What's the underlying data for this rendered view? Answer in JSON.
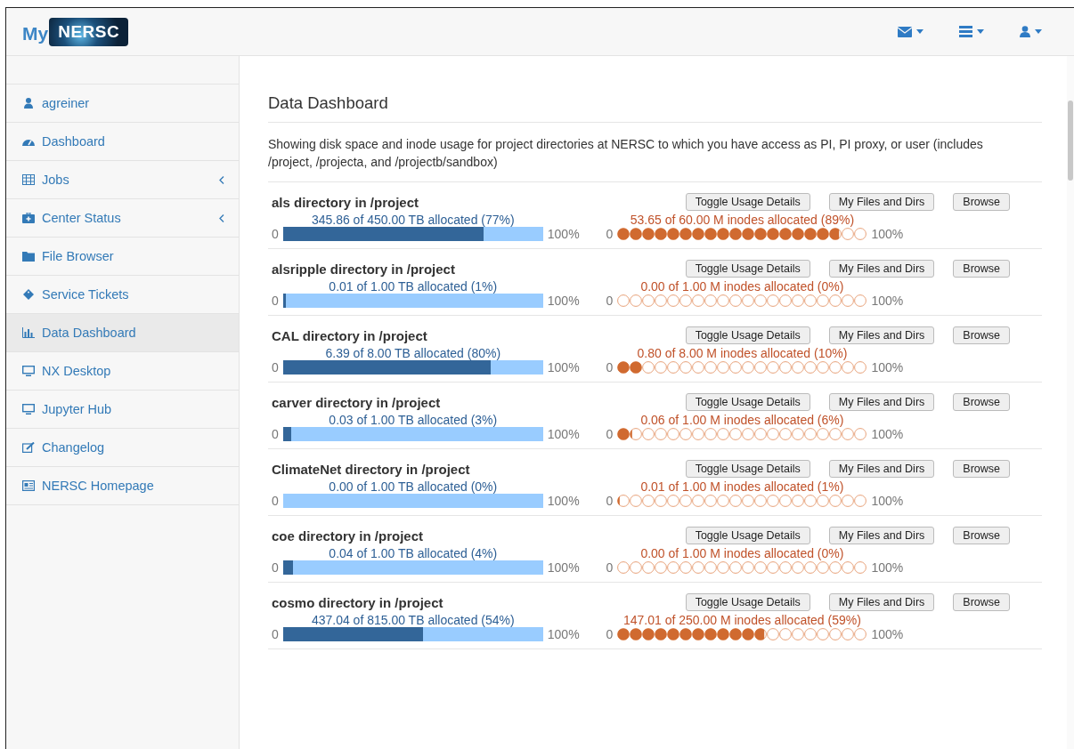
{
  "logo": {
    "prefix": "My",
    "brand": "NERSC"
  },
  "navbar": {
    "menus": [
      {
        "kind": "mail"
      },
      {
        "kind": "servers"
      },
      {
        "kind": "user"
      }
    ]
  },
  "sidebar": {
    "items": [
      {
        "label": "agreiner",
        "selected": false,
        "expandable": false
      },
      {
        "label": "Dashboard",
        "selected": false,
        "expandable": false
      },
      {
        "label": "Jobs",
        "selected": false,
        "expandable": true
      },
      {
        "label": "Center Status",
        "selected": false,
        "expandable": true
      },
      {
        "label": "File Browser",
        "selected": false,
        "expandable": false
      },
      {
        "label": "Service Tickets",
        "selected": false,
        "expandable": false
      },
      {
        "label": "Data Dashboard",
        "selected": true,
        "expandable": false
      },
      {
        "label": "NX Desktop",
        "selected": false,
        "expandable": false
      },
      {
        "label": "Jupyter Hub",
        "selected": false,
        "expandable": false
      },
      {
        "label": "Changelog",
        "selected": false,
        "expandable": false
      },
      {
        "label": "NERSC Homepage",
        "selected": false,
        "expandable": false
      }
    ]
  },
  "page": {
    "title": "Data Dashboard",
    "description": "Showing disk space and inode usage for project directories at NERSC to which you have access as PI, PI proxy, or user (includes /project, /projecta, and /projectb/sandbox)"
  },
  "directories": [
    {
      "name": "als directory in /project",
      "buttons": [
        "Toggle Usage Details",
        "My Files and Dirs",
        "Browse"
      ],
      "space": {
        "label": "345.86 of 450.00 TB allocated (77%)",
        "min": "0",
        "max": "100%",
        "level": 0.77
      },
      "inodes": {
        "label": "53.65 of 60.00 M inodes allocated (89%)",
        "min": "0",
        "max": "100%",
        "level": 0.89
      }
    },
    {
      "name": "alsripple directory in /project",
      "buttons": [
        "Toggle Usage Details",
        "My Files and Dirs",
        "Browse"
      ],
      "space": {
        "label": "0.01 of 1.00 TB allocated (1%)",
        "min": "0",
        "max": "100%",
        "level": 0.01
      },
      "inodes": {
        "label": "0.00 of 1.00 M inodes allocated (0%)",
        "min": "0",
        "max": "100%",
        "level": 0
      }
    },
    {
      "name": "CAL directory in /project",
      "buttons": [
        "Toggle Usage Details",
        "My Files and Dirs",
        "Browse"
      ],
      "space": {
        "label": "6.39 of 8.00 TB allocated (80%)",
        "min": "0",
        "max": "100%",
        "level": 0.8
      },
      "inodes": {
        "label": "0.80 of 8.00 M inodes allocated (10%)",
        "min": "0",
        "max": "100%",
        "level": 0.1
      }
    },
    {
      "name": "carver directory in /project",
      "buttons": [
        "Toggle Usage Details",
        "My Files and Dirs",
        "Browse"
      ],
      "space": {
        "label": "0.03 of 1.00 TB allocated (3%)",
        "min": "0",
        "max": "100%",
        "level": 0.03
      },
      "inodes": {
        "label": "0.06 of 1.00 M inodes allocated (6%)",
        "min": "0",
        "max": "100%",
        "level": 0.06
      }
    },
    {
      "name": "ClimateNet directory in /project",
      "buttons": [
        "Toggle Usage Details",
        "My Files and Dirs",
        "Browse"
      ],
      "space": {
        "label": "0.00 of 1.00 TB allocated (0%)",
        "min": "0",
        "max": "100%"
      },
      "inodes": {
        "label": "0.01 of 1.00 M inodes allocated (1%)",
        "min": "0",
        "max": "100%",
        "level": 0.01
      }
    },
    {
      "name": "coe directory in /project",
      "buttons": [
        "Toggle Usage Details",
        "My Files and Dirs",
        "Browse"
      ],
      "space": {
        "label": "0.04 of 1.00 TB allocated (4%)",
        "min": "0",
        "max": "100%",
        "level": 0.04
      },
      "inodes": {
        "label": "0.00 of 1.00 M inodes allocated (0%)",
        "min": "0",
        "max": "100%",
        "level": 0
      }
    },
    {
      "name": "cosmo directory in /project",
      "buttons": [
        "Toggle Usage Details",
        "My Files and Dirs",
        "Browse"
      ],
      "space": {
        "label": "437.04 of 815.00 TB allocated (54%)",
        "min": "0",
        "max": "100%",
        "level": 0.54
      },
      "inodes": {
        "label": "147.01 of 250.00 M inodes allocated (59%)",
        "min": "0",
        "max": "100%",
        "level": 0.59
      }
    }
  ]
}
